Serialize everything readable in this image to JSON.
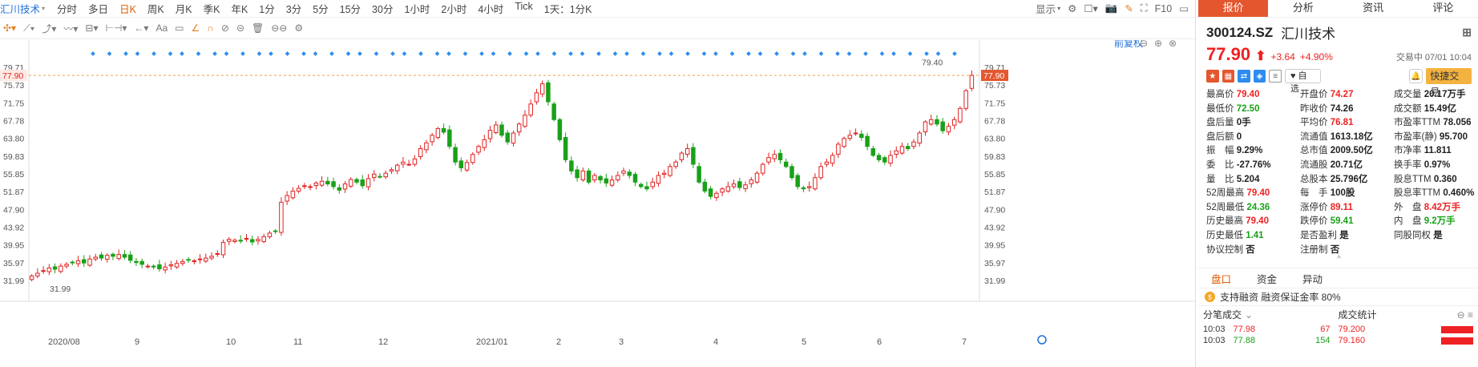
{
  "topbar": {
    "symbol": "汇川技术",
    "periods": [
      "分时",
      "多日",
      "日K",
      "周K",
      "月K",
      "季K",
      "年K",
      "1分",
      "3分",
      "5分",
      "15分",
      "30分",
      "1小时",
      "2小时",
      "4小时",
      "Tick",
      "1天：1分K"
    ],
    "active_period": "日K",
    "display_label": "显示",
    "f10_label": "F10"
  },
  "toolbar": {
    "text_tool": "Aa"
  },
  "chart": {
    "restore_label": "前复权",
    "y_ticks": [
      "79.71",
      "75.73",
      "71.75",
      "67.78",
      "63.80",
      "59.83",
      "55.85",
      "51.87",
      "47.90",
      "43.92",
      "39.95",
      "35.97",
      "31.99"
    ],
    "current_price_tag": "77.90",
    "x_labels": [
      "2020/08",
      "9",
      "10",
      "11",
      "12",
      "2021/01",
      "2",
      "3",
      "4",
      "5",
      "6",
      "7"
    ],
    "high_marker": "79.40",
    "low_marker": "31.99"
  },
  "chart_data": {
    "type": "candlestick",
    "x_range": [
      "2020/08",
      "2021/07"
    ],
    "ylim": [
      31.99,
      79.71
    ],
    "current_price": 77.9,
    "period_high": 79.4,
    "period_low": 31.99,
    "colors": {
      "up": "#e22222",
      "down": "#19a119",
      "guide": "#f0a040"
    },
    "closes": [
      33.0,
      33.6,
      34.2,
      34.8,
      34.5,
      35.2,
      35.6,
      36.0,
      36.4,
      35.9,
      36.8,
      37.2,
      37.0,
      37.6,
      37.4,
      37.8,
      37.2,
      36.5,
      36.0,
      35.6,
      35.2,
      35.0,
      34.6,
      35.0,
      35.5,
      35.8,
      36.2,
      36.6,
      36.4,
      36.8,
      37.0,
      37.4,
      38.0,
      40.5,
      41.2,
      41.0,
      40.8,
      41.4,
      40.6,
      41.2,
      41.8,
      42.6,
      43.0,
      49.5,
      51.0,
      52.0,
      52.6,
      53.2,
      53.0,
      53.8,
      54.2,
      53.6,
      53.0,
      52.2,
      53.6,
      54.6,
      54.0,
      53.2,
      54.8,
      55.8,
      55.2,
      56.0,
      56.8,
      57.8,
      58.5,
      58.0,
      59.2,
      61.5,
      62.8,
      64.5,
      66.0,
      65.2,
      62.0,
      58.5,
      57.2,
      58.4,
      60.2,
      62.0,
      63.5,
      65.6,
      66.8,
      64.5,
      63.0,
      65.0,
      67.0,
      69.0,
      71.5,
      74.0,
      76.0,
      72.0,
      68.0,
      63.5,
      59.0,
      56.5,
      55.0,
      56.5,
      54.0,
      55.5,
      54.5,
      53.8,
      54.5,
      55.5,
      56.5,
      55.5,
      54.0,
      53.0,
      52.5,
      54.0,
      55.5,
      56.0,
      57.5,
      58.5,
      60.5,
      61.5,
      58.0,
      54.0,
      52.0,
      50.8,
      51.5,
      52.5,
      53.0,
      53.6,
      52.8,
      53.4,
      54.5,
      56.0,
      58.0,
      59.5,
      60.2,
      59.0,
      57.5,
      55.0,
      53.0,
      52.5,
      53.0,
      55.0,
      57.5,
      58.5,
      60.0,
      62.5,
      63.8,
      64.5,
      65.0,
      64.0,
      62.0,
      60.0,
      59.0,
      58.5,
      60.0,
      61.0,
      62.0,
      61.5,
      63.0,
      65.0,
      67.5,
      68.0,
      67.0,
      65.5,
      66.5,
      68.0,
      70.5,
      74.5,
      77.9
    ]
  },
  "panel": {
    "tabs": [
      "报价",
      "分析",
      "资讯",
      "评论"
    ],
    "active_tab": "报价",
    "code": "300124.SZ",
    "name": "汇川技术",
    "price": "77.90",
    "change": "+3.64",
    "change_pct": "+4.90%",
    "status": "交易中 07/01 10:04",
    "add_watch": "自选",
    "fast_trade": "快捷交易",
    "rows": [
      [
        [
          "最高价",
          "79.40",
          "red"
        ],
        [
          "开盘价",
          "74.27",
          "red"
        ],
        [
          "成交量",
          "20.17万手",
          "blk"
        ]
      ],
      [
        [
          "最低价",
          "72.50",
          "green"
        ],
        [
          "昨收价",
          "74.26",
          "blk"
        ],
        [
          "成交额",
          "15.49亿",
          "blk"
        ]
      ],
      [
        [
          "盘后量",
          "0手",
          "blk"
        ],
        [
          "平均价",
          "76.81",
          "red"
        ],
        [
          "市盈率TTM",
          "78.056",
          "blk"
        ]
      ],
      [
        [
          "盘后额",
          "0",
          "blk"
        ],
        [
          "流通值",
          "1613.18亿",
          "blk"
        ],
        [
          "市盈率(静)",
          "95.700",
          "blk"
        ]
      ],
      [
        [
          "振　幅",
          "9.29%",
          "blk"
        ],
        [
          "总市值",
          "2009.50亿",
          "blk"
        ],
        [
          "市净率",
          "11.811",
          "blk"
        ]
      ],
      [
        [
          "委　比",
          "-27.76%",
          "blk"
        ],
        [
          "流通股",
          "20.71亿",
          "blk"
        ],
        [
          "换手率",
          "0.97%",
          "blk"
        ]
      ],
      [
        [
          "量　比",
          "5.204",
          "blk"
        ],
        [
          "总股本",
          "25.796亿",
          "blk"
        ],
        [
          "股息TTM",
          "0.360",
          "blk"
        ]
      ],
      [
        [
          "52周最高",
          "79.40",
          "red"
        ],
        [
          "每　手",
          "100股",
          "blk"
        ],
        [
          "股息率TTM",
          "0.460%",
          "blk"
        ]
      ],
      [
        [
          "52周最低",
          "24.36",
          "green"
        ],
        [
          "涨停价",
          "89.11",
          "red"
        ],
        [
          "外　盘",
          "8.42万手",
          "red"
        ]
      ],
      [
        [
          "历史最高",
          "79.40",
          "red"
        ],
        [
          "跌停价",
          "59.41",
          "green"
        ],
        [
          "内　盘",
          "9.2万手",
          "green"
        ]
      ],
      [
        [
          "历史最低",
          "1.41",
          "green"
        ],
        [
          "是否盈利",
          "是",
          "blk"
        ],
        [
          "同股同权",
          "是",
          "blk"
        ]
      ],
      [
        [
          "协议控制",
          "否",
          "blk"
        ],
        [
          "注册制",
          "否",
          "blk"
        ],
        [
          "",
          "",
          " blk"
        ]
      ]
    ],
    "subtabs": [
      "盘口",
      "资金",
      "异动"
    ],
    "active_subtab": "盘口",
    "margin_text": "支持融资 融资保证金率 80%",
    "ticks_header": "分笔成交",
    "ticks": [
      [
        "10:03",
        "77.98",
        "67"
      ],
      [
        "10:03",
        "77.88",
        "154"
      ]
    ],
    "stats_header": "成交统计",
    "stats_values": [
      "79.200",
      "79.160"
    ]
  }
}
